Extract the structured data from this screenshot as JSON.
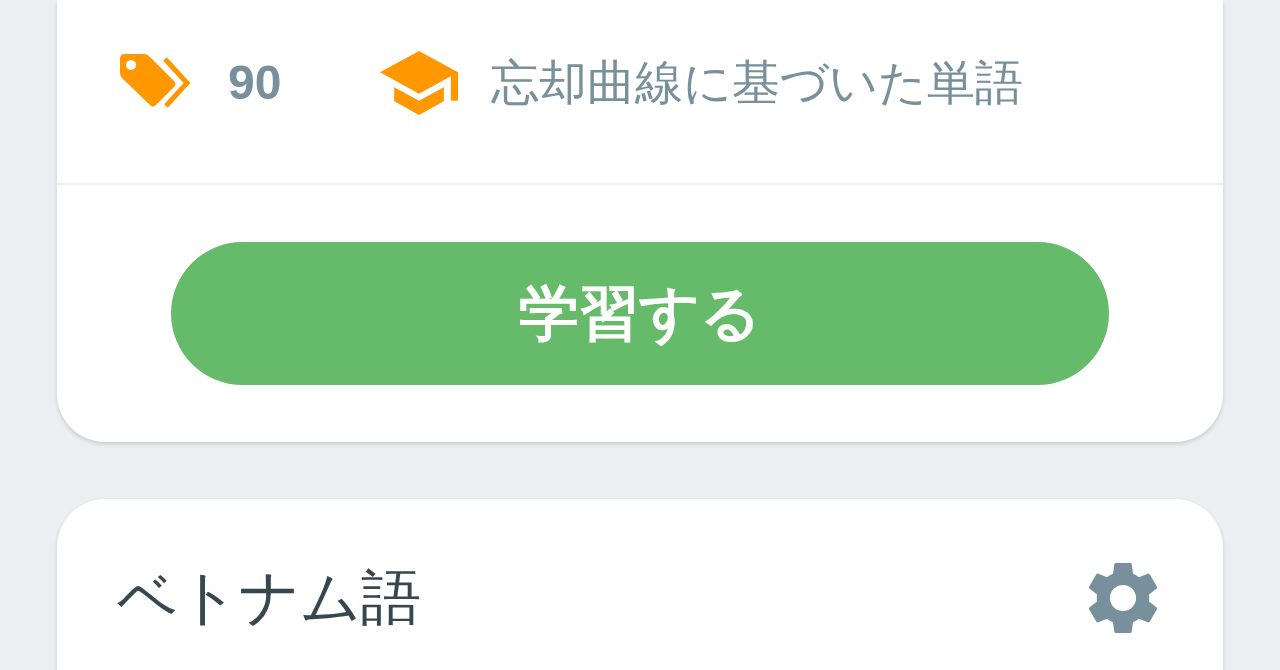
{
  "study_card": {
    "stats": [
      {
        "kind": "tag_count",
        "text": "90"
      },
      {
        "kind": "mode",
        "text": "忘却曲線に基づいた単語"
      }
    ],
    "study_button": {
      "label": "学習する"
    }
  },
  "language_card": {
    "title": "ベトナム語"
  }
}
